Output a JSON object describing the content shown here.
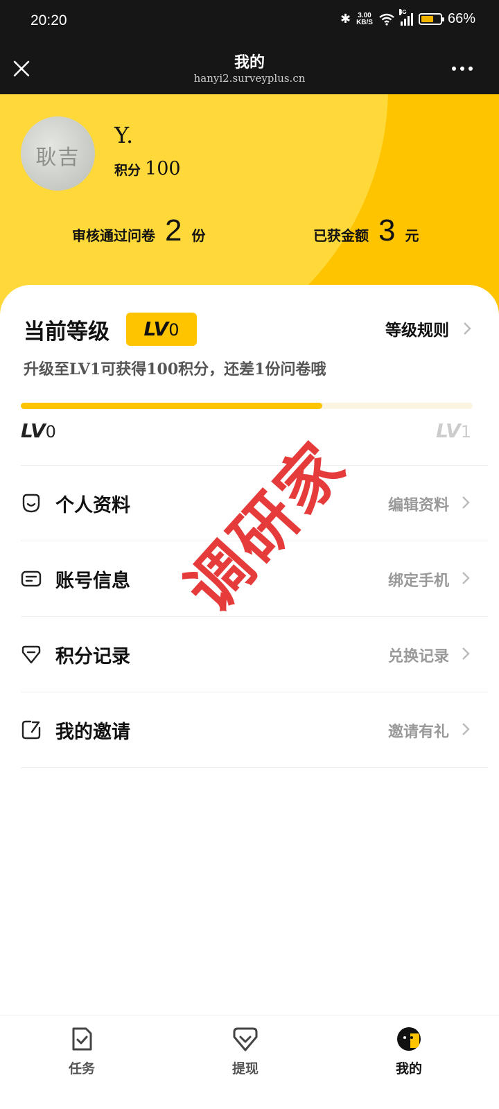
{
  "status_bar": {
    "time": "20:20",
    "net_speed": "3.00",
    "net_unit": "KB/S",
    "network": "4G",
    "battery_level": 0.66,
    "battery_text": "66%"
  },
  "titlebar": {
    "title": "我的",
    "url": "hanyi2.surveyplus.cn"
  },
  "profile": {
    "avatar_text": "耿吉",
    "name": "Y.",
    "points_label": "积分",
    "points_value": "100"
  },
  "stats": {
    "approved_label": "审核通过问卷",
    "approved_value": "2",
    "approved_unit": "份",
    "earned_label": "已获金额",
    "earned_value": "3",
    "earned_unit": "元"
  },
  "level": {
    "title": "当前等级",
    "badge_prefix": "LV",
    "badge_num": "0",
    "rules_label": "等级规则",
    "description": "升级至LV1可获得100积分，还差1份问卷哦",
    "progress": 0.667,
    "start_prefix": "LV",
    "start_num": "0",
    "end_prefix": "LV",
    "end_num": "1"
  },
  "menu": [
    {
      "label": "个人资料",
      "action": "编辑资料",
      "icon": "smile-face-icon"
    },
    {
      "label": "账号信息",
      "action": "绑定手机",
      "icon": "id-card-icon"
    },
    {
      "label": "积分记录",
      "action": "兑换记录",
      "icon": "gem-icon"
    },
    {
      "label": "我的邀请",
      "action": "邀请有礼",
      "icon": "invite-icon"
    }
  ],
  "watermark": "调研家",
  "nav": {
    "items": [
      {
        "label": "任务",
        "icon": "task-icon"
      },
      {
        "label": "提现",
        "icon": "withdraw-icon"
      },
      {
        "label": "我的",
        "icon": "profile-face-icon"
      }
    ],
    "active": "我的"
  },
  "colors": {
    "accent": "#ffc400",
    "accent_light": "#ffd83a",
    "watermark": "#e22020",
    "dark_bar": "#161616"
  }
}
